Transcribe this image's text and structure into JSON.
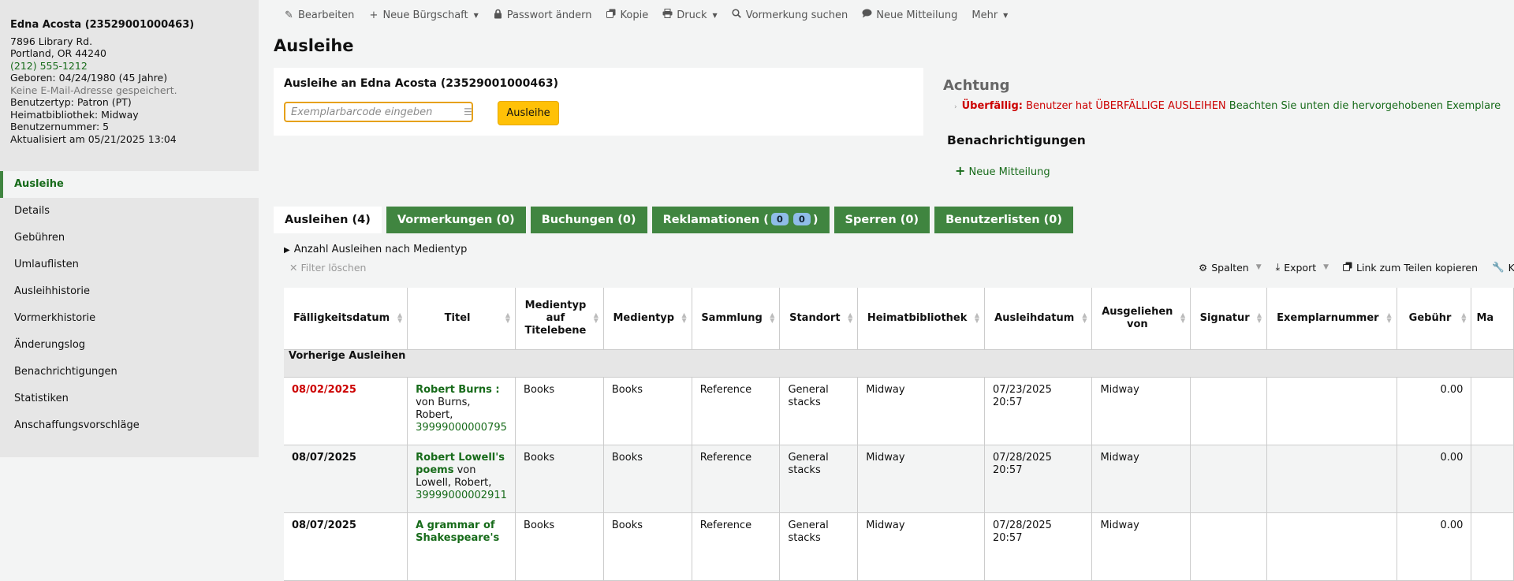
{
  "patron": {
    "name": "Edna Acosta (23529001000463)",
    "address": "7896 Library Rd.",
    "city": "Portland, OR 44240",
    "phone": "(212) 555-1212",
    "born": "Geboren: 04/24/1980 (45 Jahre)",
    "email": "Keine E-Mail-Adresse gespeichert.",
    "category": "Benutzertyp: Patron (PT)",
    "library": "Heimatbibliothek: Midway",
    "number": "Benutzernummer: 5",
    "updated": "Aktualisiert am 05/21/2025 13:04"
  },
  "sidebar": {
    "items": [
      {
        "label": "Ausleihe"
      },
      {
        "label": "Details"
      },
      {
        "label": "Gebühren"
      },
      {
        "label": "Umlauflisten"
      },
      {
        "label": "Ausleihhistorie"
      },
      {
        "label": "Vormerkhistorie"
      },
      {
        "label": "Änderungslog"
      },
      {
        "label": "Benachrichtigungen"
      },
      {
        "label": "Statistiken"
      },
      {
        "label": "Anschaffungsvorschläge"
      }
    ]
  },
  "toolbar": {
    "edit": "Bearbeiten",
    "guarantor": "Neue Bürgschaft",
    "password": "Passwort ändern",
    "duplicate": "Kopie",
    "print": "Druck",
    "search_hold": "Vormerkung suchen",
    "new_message": "Neue Mitteilung",
    "more": "Mehr"
  },
  "page": {
    "title": "Ausleihe"
  },
  "checkout": {
    "title": "Ausleihe an Edna Acosta (23529001000463)",
    "placeholder": "Exemplarbarcode eingeben",
    "value": "",
    "button": "Ausleihe"
  },
  "attention": {
    "title": "Achtung",
    "overdue_label": "Überfällig:",
    "overdue_text": "Benutzer hat ÜBERFÄLLIGE AUSLEIHEN",
    "overdue_link": "Beachten Sie unten die hervorgehobenen Exemplare"
  },
  "notifications": {
    "title": "Benachrichtigungen",
    "new_message": "Neue Mitteilung"
  },
  "tabs": {
    "checkouts": "Ausleihen (4)",
    "holds": "Vormerkungen (0)",
    "bookings": "Buchungen (0)",
    "claims_prefix": "Reklamationen (",
    "claims_a": "0",
    "claims_b": "0",
    "claims_suffix": ")",
    "restrictions": "Sperren (0)",
    "lists": "Benutzerlisten (0)"
  },
  "summary": "Anzahl Ausleihen nach Medientyp",
  "clear_filter": "Filter löschen",
  "table_tools": {
    "columns": "Spalten",
    "export": "Export",
    "share": "Link zum Teilen kopieren",
    "config": "K"
  },
  "table": {
    "headers": [
      "Fälligkeitsdatum",
      "Titel",
      "Medientyp auf Titelebene",
      "Medientyp",
      "Sammlung",
      "Standort",
      "Heimatbibliothek",
      "Ausleihdatum",
      "Ausgeliehen von",
      "Signatur",
      "Exemplarnummer",
      "Gebühr",
      "Ma"
    ],
    "group_label": "Vorherige Ausleihen",
    "rows": [
      {
        "due": "08/02/2025",
        "title": "Robert Burns :",
        "by": " von Burns, Robert,",
        "barcode": "39999000000795",
        "itype_bib": "Books",
        "itype": "Books",
        "collection": "Reference",
        "location": "General stacks",
        "home": "Midway",
        "issued": "07/23/2025 20:57",
        "checked_out_from": "Midway",
        "callnumber": "",
        "copynumber": "",
        "charge": "0.00"
      },
      {
        "due": "08/07/2025",
        "title": "Robert Lowell's poems",
        "by": " von Lowell, Robert,",
        "barcode": "39999000002911",
        "itype_bib": "Books",
        "itype": "Books",
        "collection": "Reference",
        "location": "General stacks",
        "home": "Midway",
        "issued": "07/28/2025 20:57",
        "checked_out_from": "Midway",
        "callnumber": "",
        "copynumber": "",
        "charge": "0.00"
      },
      {
        "due": "08/07/2025",
        "title": "A grammar of Shakespeare's",
        "by": "",
        "barcode": "",
        "itype_bib": "Books",
        "itype": "Books",
        "collection": "Reference",
        "location": "General stacks",
        "home": "Midway",
        "issued": "07/28/2025 20:57",
        "checked_out_from": "Midway",
        "callnumber": "",
        "copynumber": "",
        "charge": "0.00"
      }
    ]
  }
}
